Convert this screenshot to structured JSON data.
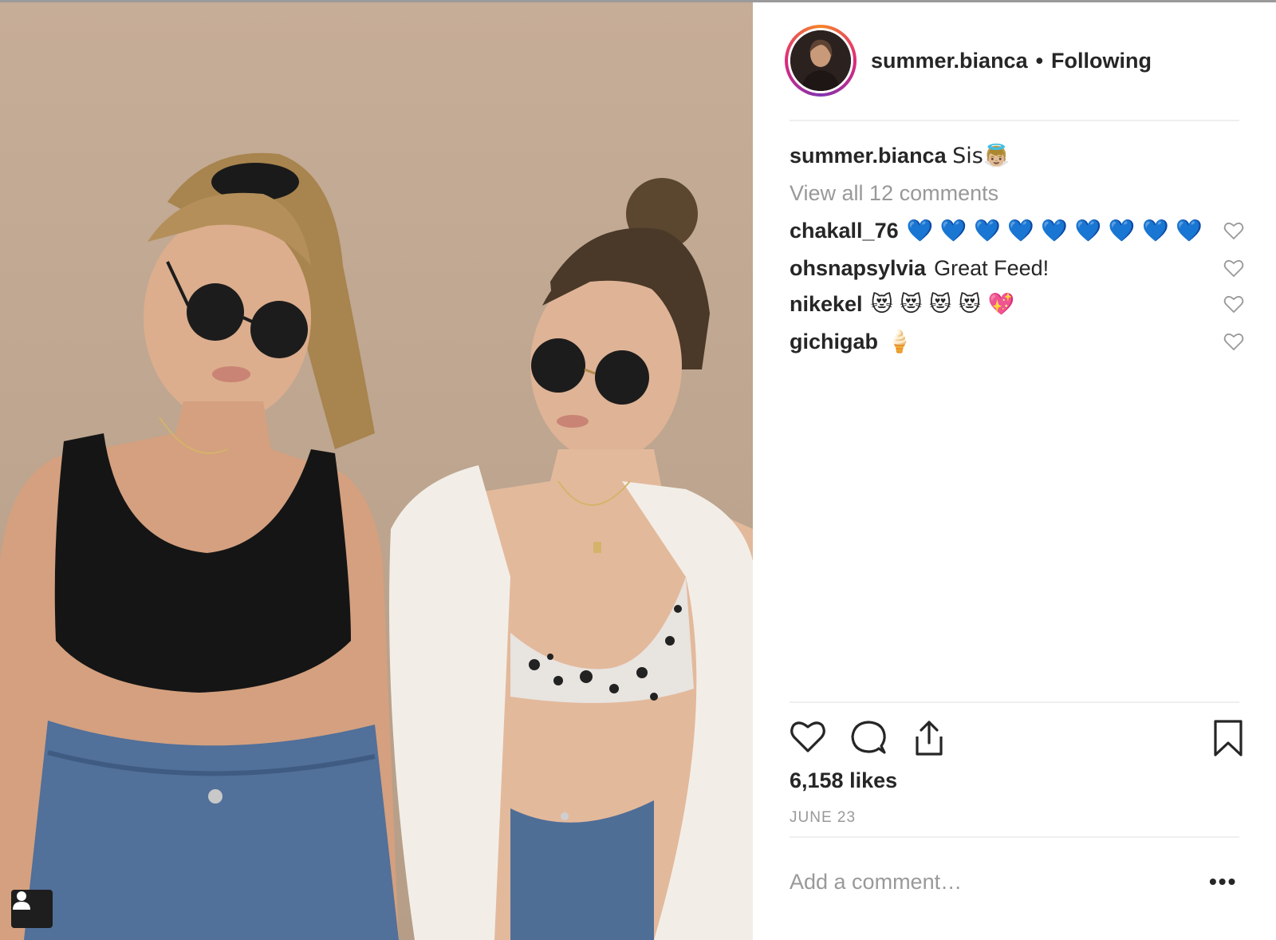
{
  "post": {
    "username": "summer.bianca",
    "separator": "•",
    "follow_status": "Following",
    "caption_user": "summer.bianca",
    "caption_text": "Sis👼🏼",
    "view_all": "View all 12 comments",
    "likes": "6,158 likes",
    "date": "JUNE 23",
    "add_comment_placeholder": "Add a comment…",
    "more_label": "•••"
  },
  "comments": [
    {
      "user": "chakall_76",
      "text": "💙 💙 💙 💙 💙 💙 💙 💙 💙"
    },
    {
      "user": "ohsnapsylvia",
      "text": "Great Feed!"
    },
    {
      "user": "nikekel",
      "text": "😻 😻 😻 😻 💖"
    },
    {
      "user": "gichigab",
      "text": "🍦"
    }
  ],
  "icons": {
    "like": "heart-icon",
    "comment": "comment-icon",
    "share": "share-icon",
    "save": "bookmark-icon",
    "tag": "user-tag-icon",
    "comment_like": "small-heart-icon"
  },
  "colors": {
    "text": "#262626",
    "muted": "#999999",
    "divider": "#efefef",
    "story_ring_start": "#f58529",
    "story_ring_end": "#8134af"
  }
}
